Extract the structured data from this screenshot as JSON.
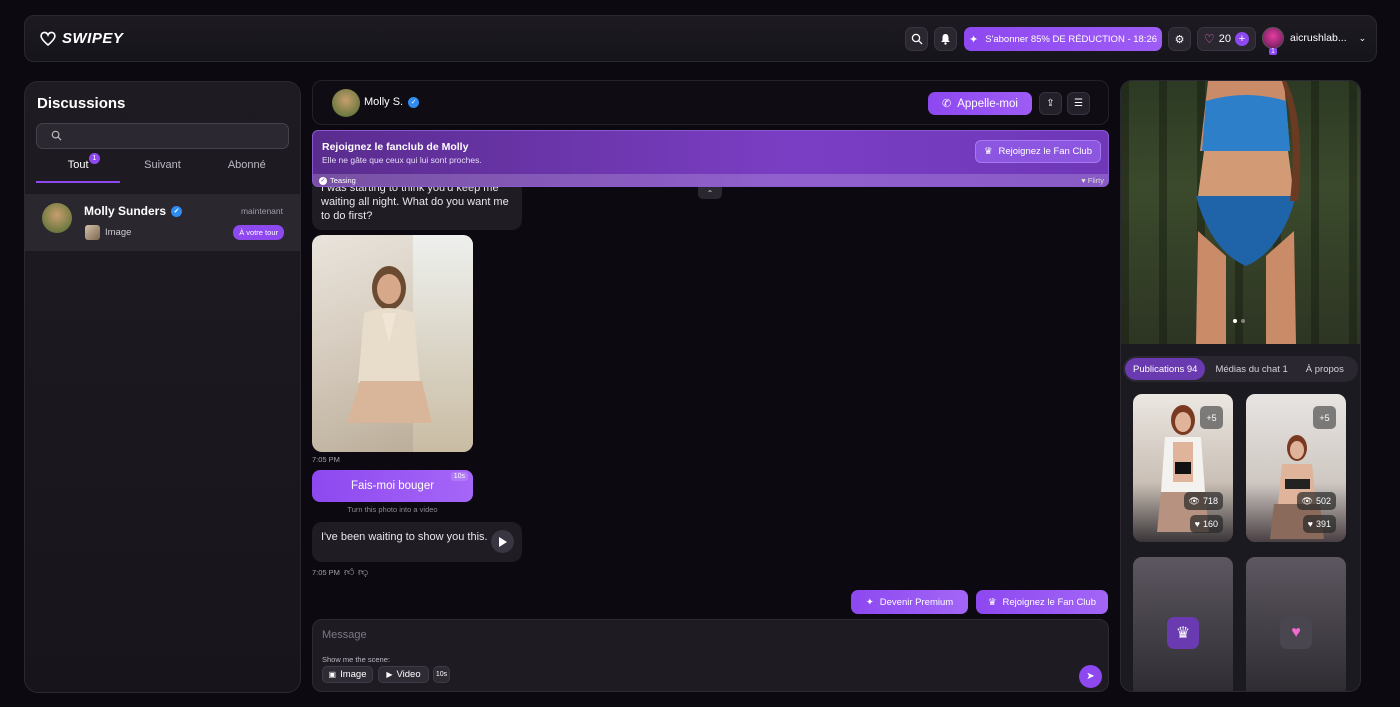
{
  "header": {
    "logo_text": "SWIPEY",
    "subscribe_label": "S'abonner 85% DE RÉDUCTION - 18:26",
    "credits": "20",
    "credits_plus": "+",
    "user_badge": "1",
    "username": "aicrushlab..."
  },
  "sidebar": {
    "title": "Discussions",
    "search_placeholder": "",
    "tabs": [
      {
        "label": "Tout",
        "badge": "1"
      },
      {
        "label": "Suivant"
      },
      {
        "label": "Abonné"
      }
    ],
    "conversations": [
      {
        "name": "Molly Sunders",
        "time": "maintenant",
        "preview": "Image",
        "turn_badge": "À votre tour"
      }
    ]
  },
  "chat": {
    "contact_name": "Molly S.",
    "call_label": "Appelle-moi",
    "fanclub": {
      "title": "Rejoignez le fanclub de Molly",
      "subtitle": "Elle ne gâte que ceux qui lui sont proches.",
      "join_label": "Rejoignez le Fan Club",
      "mood_left": "Teasing",
      "mood_right": "Flirty"
    },
    "messages": [
      {
        "text": "I was starting to think you'd keep me waiting all night. What do you want me to do first?"
      },
      {
        "time": "7:05 PM"
      },
      {
        "move_label": "Fais-moi bouger",
        "move_tag": "10s",
        "caption": "Turn this photo into a video"
      },
      {
        "text": "I've been waiting to show you this.",
        "time": "7:05 PM"
      }
    ],
    "premium_label": "Devenir Premium",
    "fanclub_label": "Rejoignez le Fan Club",
    "composer": {
      "placeholder": "Message",
      "scene_label": "Show me the scene:",
      "image_chip": "Image",
      "video_chip": "Video",
      "duration_chip": "10s"
    }
  },
  "profile": {
    "tabs": [
      "Publications 94",
      "Médias du chat 1",
      "À propos"
    ],
    "cards": [
      {
        "more": "+5",
        "views": "718",
        "likes": "160"
      },
      {
        "more": "+5",
        "views": "502",
        "likes": "391"
      }
    ]
  },
  "colors": {
    "accent": "#8d48f0",
    "background": "#0c0a10",
    "verified": "#2f8cf0"
  }
}
